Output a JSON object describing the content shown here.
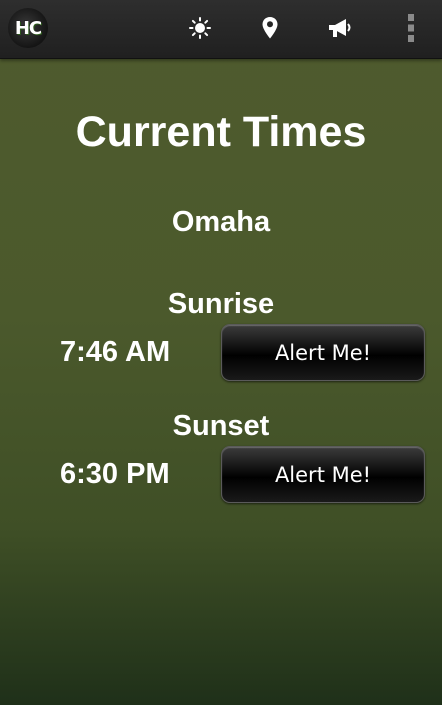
{
  "app": {
    "logo_text": "HC"
  },
  "toolbar": {
    "icons": [
      "sun-icon",
      "location-pin-icon",
      "megaphone-icon",
      "overflow-menu-icon"
    ]
  },
  "main": {
    "title": "Current Times",
    "city": "Omaha",
    "events": [
      {
        "label": "Sunrise",
        "time": "7:46 AM",
        "button_label": "Alert Me!"
      },
      {
        "label": "Sunset",
        "time": "6:30 PM",
        "button_label": "Alert Me!"
      }
    ]
  },
  "colors": {
    "background_top": "#4f5b2e",
    "background_bottom": "#1f3019",
    "action_bar": "#262626",
    "button": "#000000",
    "text": "#ffffff"
  }
}
